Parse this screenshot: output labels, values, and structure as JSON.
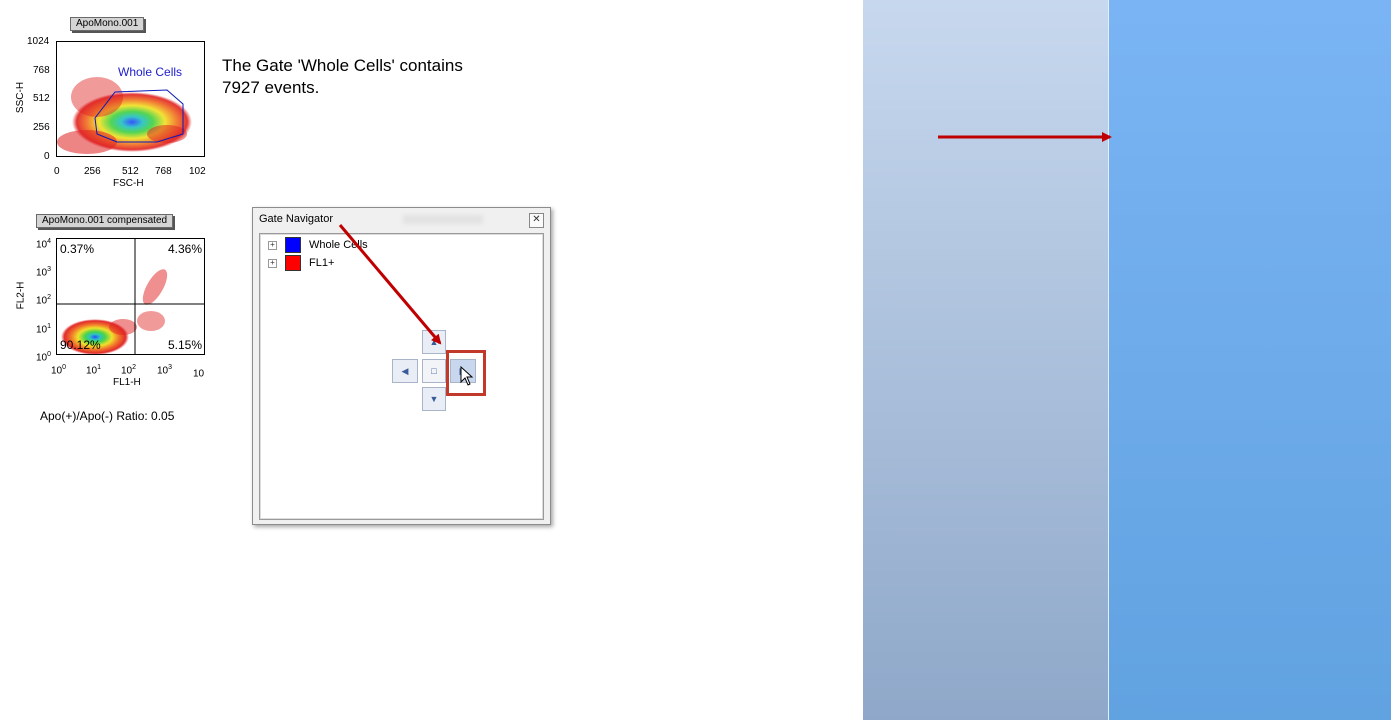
{
  "plot1": {
    "title": "ApoMono.001",
    "gate_label": "Whole Cells",
    "y_axis_label": "SSC-H",
    "x_axis_label": "FSC-H",
    "y_ticks": [
      "1024",
      "768",
      "512",
      "256",
      "0"
    ],
    "x_ticks": [
      "0",
      "256",
      "512",
      "768",
      "102"
    ]
  },
  "message": {
    "line1": "The Gate 'Whole Cells' contains",
    "line2": "7927 events."
  },
  "plot2": {
    "title": "ApoMono.001 compensated",
    "y_axis_label": "FL2-H",
    "x_axis_label": "FL1-H",
    "quadrants": {
      "upper_left": "0.37%",
      "upper_right": "4.36%",
      "lower_left": "90.12%",
      "lower_right": "5.15%"
    },
    "y_ticks": [
      {
        "base": "10",
        "exp": "4"
      },
      {
        "base": "10",
        "exp": "3"
      },
      {
        "base": "10",
        "exp": "2"
      },
      {
        "base": "10",
        "exp": "1"
      },
      {
        "base": "10",
        "exp": "0"
      }
    ],
    "x_ticks": [
      {
        "base": "10",
        "exp": "0"
      },
      {
        "base": "10",
        "exp": "1"
      },
      {
        "base": "10",
        "exp": "2"
      },
      {
        "base": "10",
        "exp": "3"
      },
      {
        "base": "10",
        "exp": ""
      }
    ]
  },
  "ratio_text": "Apo(+)/Apo(-) Ratio: 0.05",
  "gate_navigator": {
    "title": "Gate Navigator",
    "close_icon": "close-icon",
    "items": [
      {
        "label": "Whole Cells",
        "color": "#0000ff"
      },
      {
        "label": "FL1+",
        "color": "#ff0000"
      }
    ]
  },
  "colors": {
    "arrow": "#c00000",
    "highlight": "#c0392b",
    "panel_left": "#b4c8e2",
    "panel_right": "#6daaea"
  }
}
